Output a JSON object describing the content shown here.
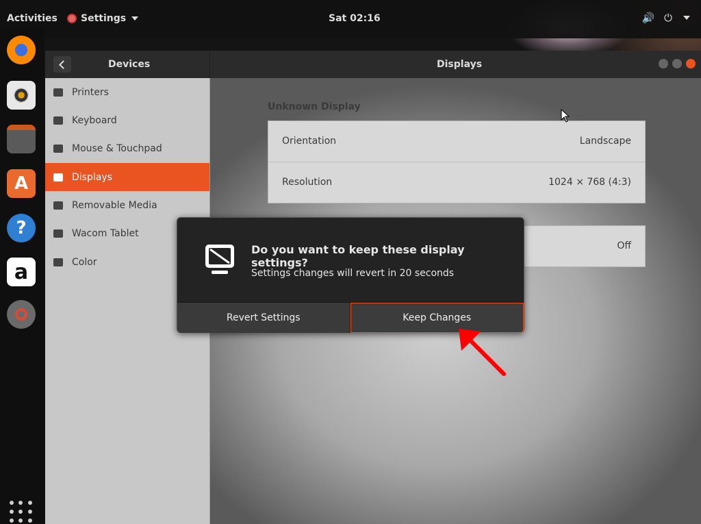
{
  "topbar": {
    "activities": "Activities",
    "app_menu": "Settings",
    "clock": "Sat 02:16",
    "icons": [
      "speaker-icon",
      "power-icon",
      "chevron-down-icon"
    ]
  },
  "dock": {
    "items": [
      "firefox",
      "rhythmbox",
      "files",
      "software-center",
      "help",
      "amazon",
      "settings",
      "show-applications"
    ]
  },
  "window": {
    "sidebar_title": "Devices",
    "content_title": "Displays",
    "sidebar_items": [
      {
        "label": "Printers",
        "icon": "printer-icon",
        "active": false
      },
      {
        "label": "Keyboard",
        "icon": "keyboard-icon",
        "active": false
      },
      {
        "label": "Mouse & Touchpad",
        "icon": "mouse-icon",
        "active": false
      },
      {
        "label": "Displays",
        "icon": "display-icon",
        "active": true
      },
      {
        "label": "Removable Media",
        "icon": "usb-icon",
        "active": false
      },
      {
        "label": "Wacom Tablet",
        "icon": "tablet-icon",
        "active": false
      },
      {
        "label": "Color",
        "icon": "color-icon",
        "active": false
      }
    ],
    "display_section": "Unknown Display",
    "rows": [
      {
        "key": "Orientation",
        "value": "Landscape"
      },
      {
        "key": "Resolution",
        "value": "1024 × 768 (4:3)"
      }
    ],
    "night_light_value": "Off"
  },
  "dialog": {
    "title": "Do you want to keep these display settings?",
    "subtitle": "Settings changes will revert in 20 seconds",
    "revert_label": "Revert Settings",
    "keep_label": "Keep Changes"
  },
  "colors": {
    "accent": "#e95420",
    "annotation_arrow": "#ff0000"
  }
}
